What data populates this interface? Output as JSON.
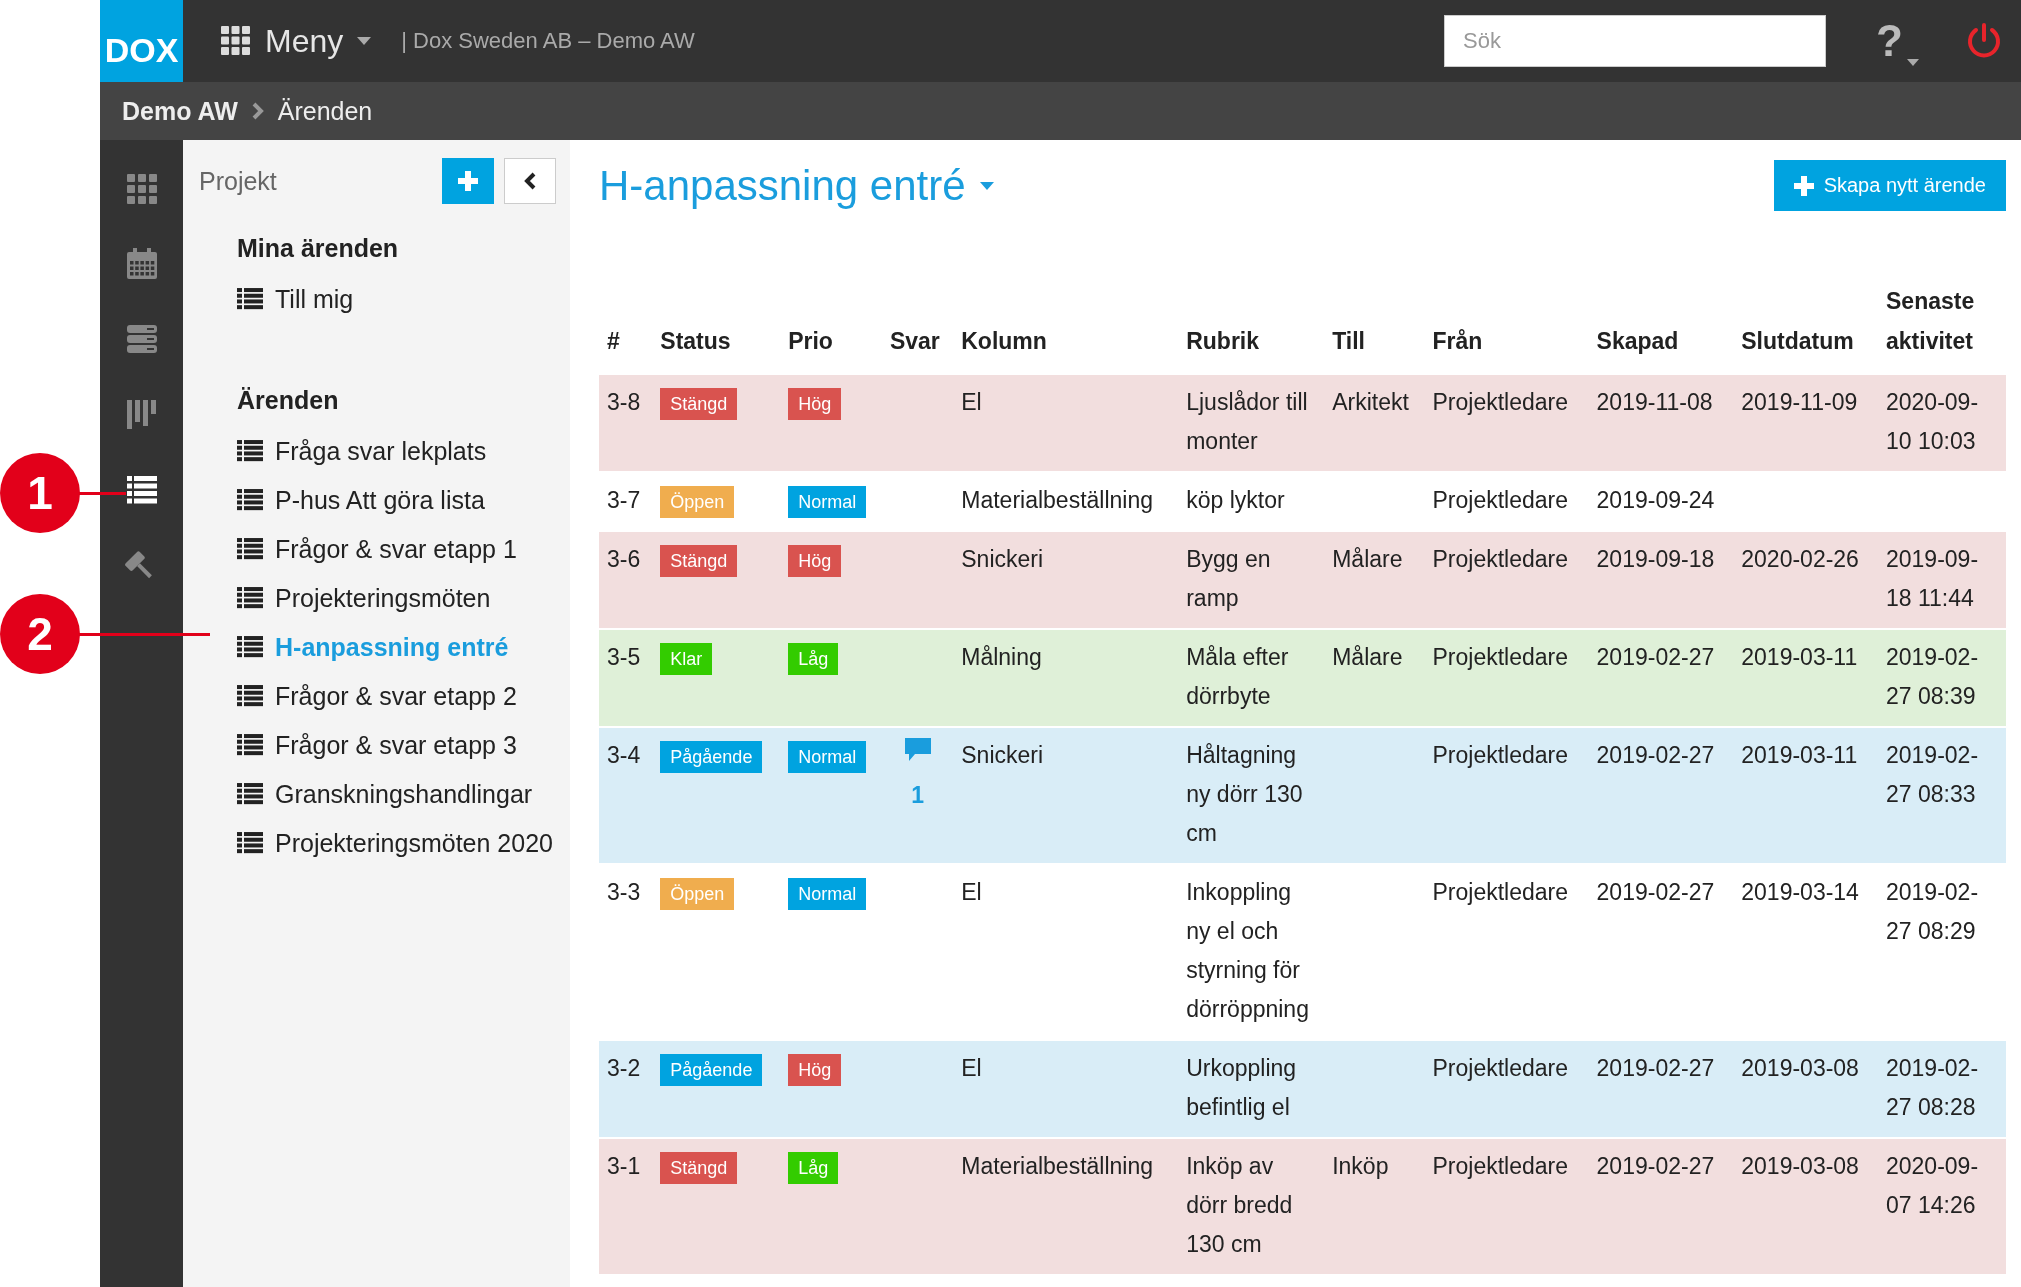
{
  "topbar": {
    "logo": "DOX",
    "menu_label": "Meny",
    "company": "| Dox Sweden AB – Demo AW",
    "search": {
      "placeholder": "Sök"
    },
    "help": "?"
  },
  "breadcrumb": [
    "Demo AW",
    "Ärenden"
  ],
  "rail": [
    {
      "kind": "grid",
      "selected": false
    },
    {
      "kind": "calendar",
      "selected": false
    },
    {
      "kind": "stack",
      "selected": false
    },
    {
      "kind": "board",
      "selected": false
    },
    {
      "kind": "list",
      "selected": true
    },
    {
      "kind": "gavel",
      "selected": false
    }
  ],
  "panel": {
    "title": "Projekt",
    "sections": [
      {
        "heading": "Mina ärenden",
        "items": [
          {
            "label": "Till mig",
            "selected": false
          }
        ]
      },
      {
        "heading": "Ärenden",
        "items": [
          {
            "label": "Fråga svar lekplats",
            "selected": false
          },
          {
            "label": "P-hus Att göra lista",
            "selected": false
          },
          {
            "label": "Frågor & svar etapp 1",
            "selected": false
          },
          {
            "label": "Projekteringsmöten",
            "selected": false
          },
          {
            "label": "H-anpassning entré",
            "selected": true
          },
          {
            "label": "Frågor & svar etapp 2",
            "selected": false
          },
          {
            "label": "Frågor & svar etapp 3",
            "selected": false
          },
          {
            "label": "Granskningshandlingar",
            "selected": false
          },
          {
            "label": "Projekteringsmöten 2020",
            "selected": false
          }
        ]
      }
    ]
  },
  "main": {
    "title": "H-anpassning entré",
    "create_button": "Skapa nytt ärende"
  },
  "table": {
    "columns": [
      "#",
      "Status",
      "Prio",
      "Svar",
      "Kolumn",
      "Rubrik",
      "Till",
      "Från",
      "Skapad",
      "Slutdatum",
      "Senaste aktivitet"
    ],
    "rows": [
      {
        "id": "3-8",
        "status": {
          "label": "Stängd",
          "kind": "closed"
        },
        "prio": {
          "label": "Hög",
          "kind": "high"
        },
        "kolumn": "El",
        "rubrik": "Ljuslådor till monter",
        "till": "Arkitekt",
        "fran": "Projektledare",
        "skapad": "2019-11-08",
        "slutdatum": "2019-11-09",
        "senaste": "2020-09-10 10:03"
      },
      {
        "id": "3-7",
        "status": {
          "label": "Öppen",
          "kind": "open"
        },
        "prio": {
          "label": "Normal",
          "kind": "normal"
        },
        "kolumn": "Materialbeställning",
        "rubrik": "köp lyktor",
        "fran": "Projektledare",
        "skapad": "2019-09-24"
      },
      {
        "id": "3-6",
        "status": {
          "label": "Stängd",
          "kind": "closed"
        },
        "prio": {
          "label": "Hög",
          "kind": "high"
        },
        "kolumn": "Snickeri",
        "rubrik": "Bygg en ramp",
        "till": "Målare",
        "fran": "Projektledare",
        "skapad": "2019-09-18",
        "slutdatum": "2020-02-26",
        "senaste": "2019-09-18 11:44"
      },
      {
        "id": "3-5",
        "status": {
          "label": "Klar",
          "kind": "done"
        },
        "prio": {
          "label": "Låg",
          "kind": "low"
        },
        "kolumn": "Målning",
        "rubrik": "Måla efter dörrbyte",
        "till": "Målare",
        "fran": "Projektledare",
        "skapad": "2019-02-27",
        "slutdatum": "2019-03-11",
        "senaste": "2019-02-27 08:39"
      },
      {
        "id": "3-4",
        "status": {
          "label": "Pågående",
          "kind": "progress"
        },
        "prio": {
          "label": "Normal",
          "kind": "normal"
        },
        "replies": "1",
        "kolumn": "Snickeri",
        "rubrik": "Håltagning ny dörr 130 cm",
        "fran": "Projektledare",
        "skapad": "2019-02-27",
        "slutdatum": "2019-03-11",
        "senaste": "2019-02-27 08:33"
      },
      {
        "id": "3-3",
        "status": {
          "label": "Öppen",
          "kind": "open"
        },
        "prio": {
          "label": "Normal",
          "kind": "normal"
        },
        "kolumn": "El",
        "rubrik": "Inkoppling ny el och styrning för dörröppning",
        "fran": "Projektledare",
        "skapad": "2019-02-27",
        "slutdatum": "2019-03-14",
        "senaste": "2019-02-27 08:29"
      },
      {
        "id": "3-2",
        "status": {
          "label": "Pågående",
          "kind": "progress"
        },
        "prio": {
          "label": "Hög",
          "kind": "high"
        },
        "kolumn": "El",
        "rubrik": "Urkoppling befintlig el",
        "fran": "Projektledare",
        "skapad": "2019-02-27",
        "slutdatum": "2019-03-08",
        "senaste": "2019-02-27 08:28"
      },
      {
        "id": "3-1",
        "status": {
          "label": "Stängd",
          "kind": "closed"
        },
        "prio": {
          "label": "Låg",
          "kind": "low"
        },
        "kolumn": "Materialbeställning",
        "rubrik": "Inköp av dörr bredd 130 cm",
        "till": "Inköp",
        "fran": "Projektledare",
        "skapad": "2019-02-27",
        "slutdatum": "2019-03-08",
        "senaste": "2020-09-07 14:26"
      }
    ]
  },
  "callouts": [
    "1",
    "2"
  ]
}
